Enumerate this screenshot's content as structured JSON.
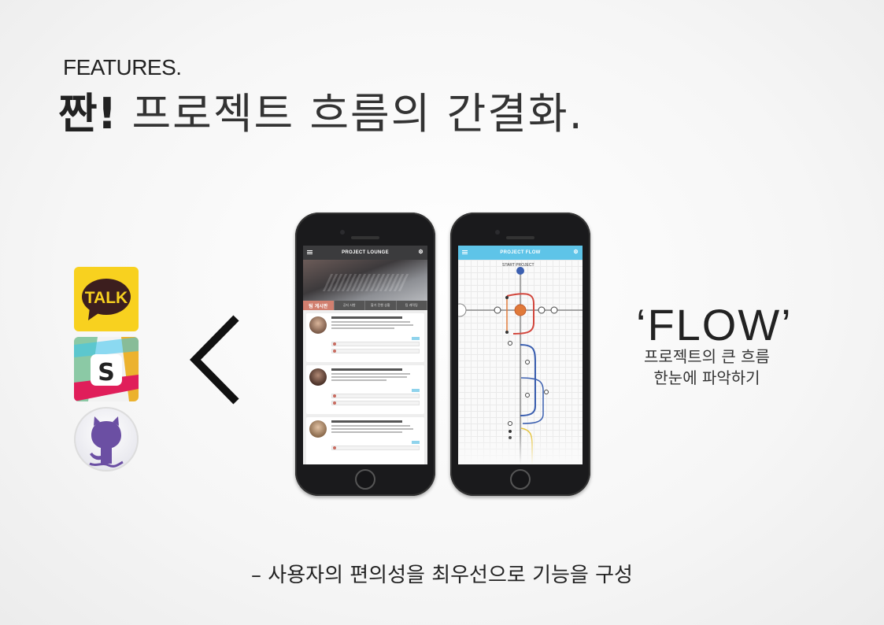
{
  "heading": {
    "kicker": "FEATURES.",
    "title_bold": "짠!",
    "title_rest": " 프로젝트 흐름의 간결화."
  },
  "integrations": {
    "kakao_label": "TALK",
    "slack_label": "S",
    "colors": {
      "kakao": "#f8d11f",
      "slack": [
        "#e01e5a",
        "#ecb22e",
        "#2eb67d",
        "#36c5f0"
      ],
      "github": "#6b4fa3"
    }
  },
  "phone_lounge": {
    "title": "PROJECT LOUNGE",
    "tabs": [
      "팀 게시판",
      "공지 사항",
      "할거 진행 상황",
      "팀 캐릭팅"
    ]
  },
  "phone_flow": {
    "title": "PROJECT FLOW",
    "start_label": "START PROJECT",
    "colors": {
      "bar": "#5ec4e8",
      "red": "#d2463c",
      "blue": "#3b5fb0",
      "yellow": "#e5c33a",
      "orange": "#e07a3a"
    }
  },
  "flow_feature": {
    "title": "‘FLOW’",
    "desc_line1": "프로젝트의 큰 흐름",
    "desc_line2": "한눈에 파악하기"
  },
  "footer": {
    "text": "– 사용자의 편의성을 최우선으로 기능을 구성"
  }
}
